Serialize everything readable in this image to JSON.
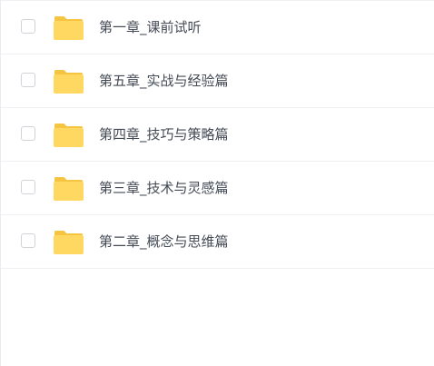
{
  "folders": [
    {
      "label": "第一章_课前试听"
    },
    {
      "label": "第五章_实战与经验篇"
    },
    {
      "label": "第四章_技巧与策略篇"
    },
    {
      "label": "第三章_技术与灵感篇"
    },
    {
      "label": "第二章_概念与思维篇"
    }
  ],
  "colors": {
    "folder_back": "#f5c542",
    "folder_front": "#ffd862",
    "text": "#444b56",
    "divider": "#eef0f3",
    "checkbox_border": "#d0d4da"
  },
  "icons": {
    "checkbox": "checkbox-icon",
    "folder": "folder-icon"
  }
}
